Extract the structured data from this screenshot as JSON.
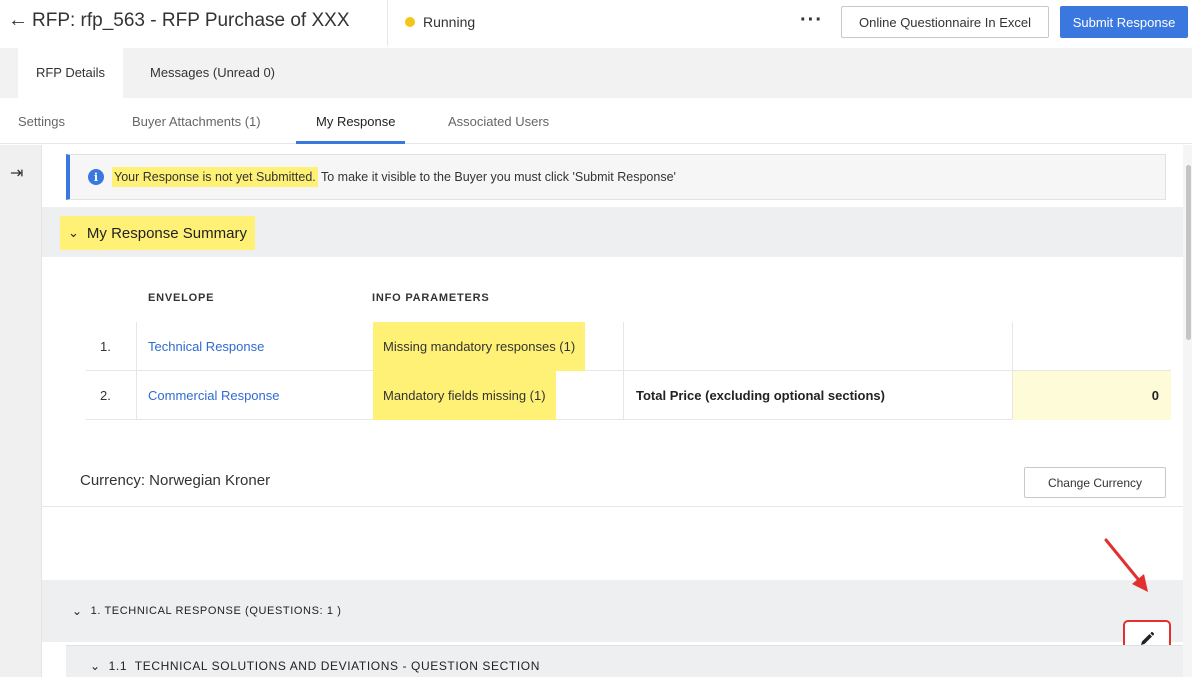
{
  "header": {
    "title": "RFP: rfp_563 - RFP Purchase of XXX",
    "status": "Running",
    "more_label": "···",
    "excel_button": "Online Questionnaire In Excel",
    "submit_button": "Submit Response",
    "accent_color": "#3a78e0",
    "status_color": "#f5c518"
  },
  "primary_tabs": {
    "rfp_details": "RFP Details",
    "messages": "Messages (Unread 0)"
  },
  "secondary_tabs": {
    "settings": "Settings",
    "buyer_attachments": "Buyer Attachments (1)",
    "my_response": "My Response",
    "associated_users": "Associated Users"
  },
  "banner": {
    "highlighted": "Your Response is not yet Submitted.",
    "text": " To make it visible to the Buyer you must click 'Submit Response'"
  },
  "summary": {
    "title": "My Response Summary",
    "col_envelope": "ENVELOPE",
    "col_info": "INFO PARAMETERS",
    "rows": [
      {
        "num": "1.",
        "envelope": "Technical Response",
        "info": "Missing mandatory responses (1)",
        "label": "",
        "value": ""
      },
      {
        "num": "2.",
        "envelope": "Commercial Response",
        "info": "Mandatory fields missing (1)",
        "label": "Total Price (excluding optional sections)",
        "value": "0"
      }
    ]
  },
  "currency": {
    "label": "Currency: Norwegian Kroner",
    "button": "Change Currency"
  },
  "sections": {
    "technical": "1. TECHNICAL RESPONSE (QUESTIONS: 1 )",
    "subsection": "1.1  TECHNICAL SOLUTIONS AND DEVIATIONS - QUESTION SECTION"
  },
  "icons": {
    "back": "arrow-left-icon",
    "collapse": "collapse-panel-icon",
    "info": "info-icon",
    "chevron": "chevron-down-icon",
    "edit": "pencil-icon",
    "annotation": "red-arrow"
  }
}
